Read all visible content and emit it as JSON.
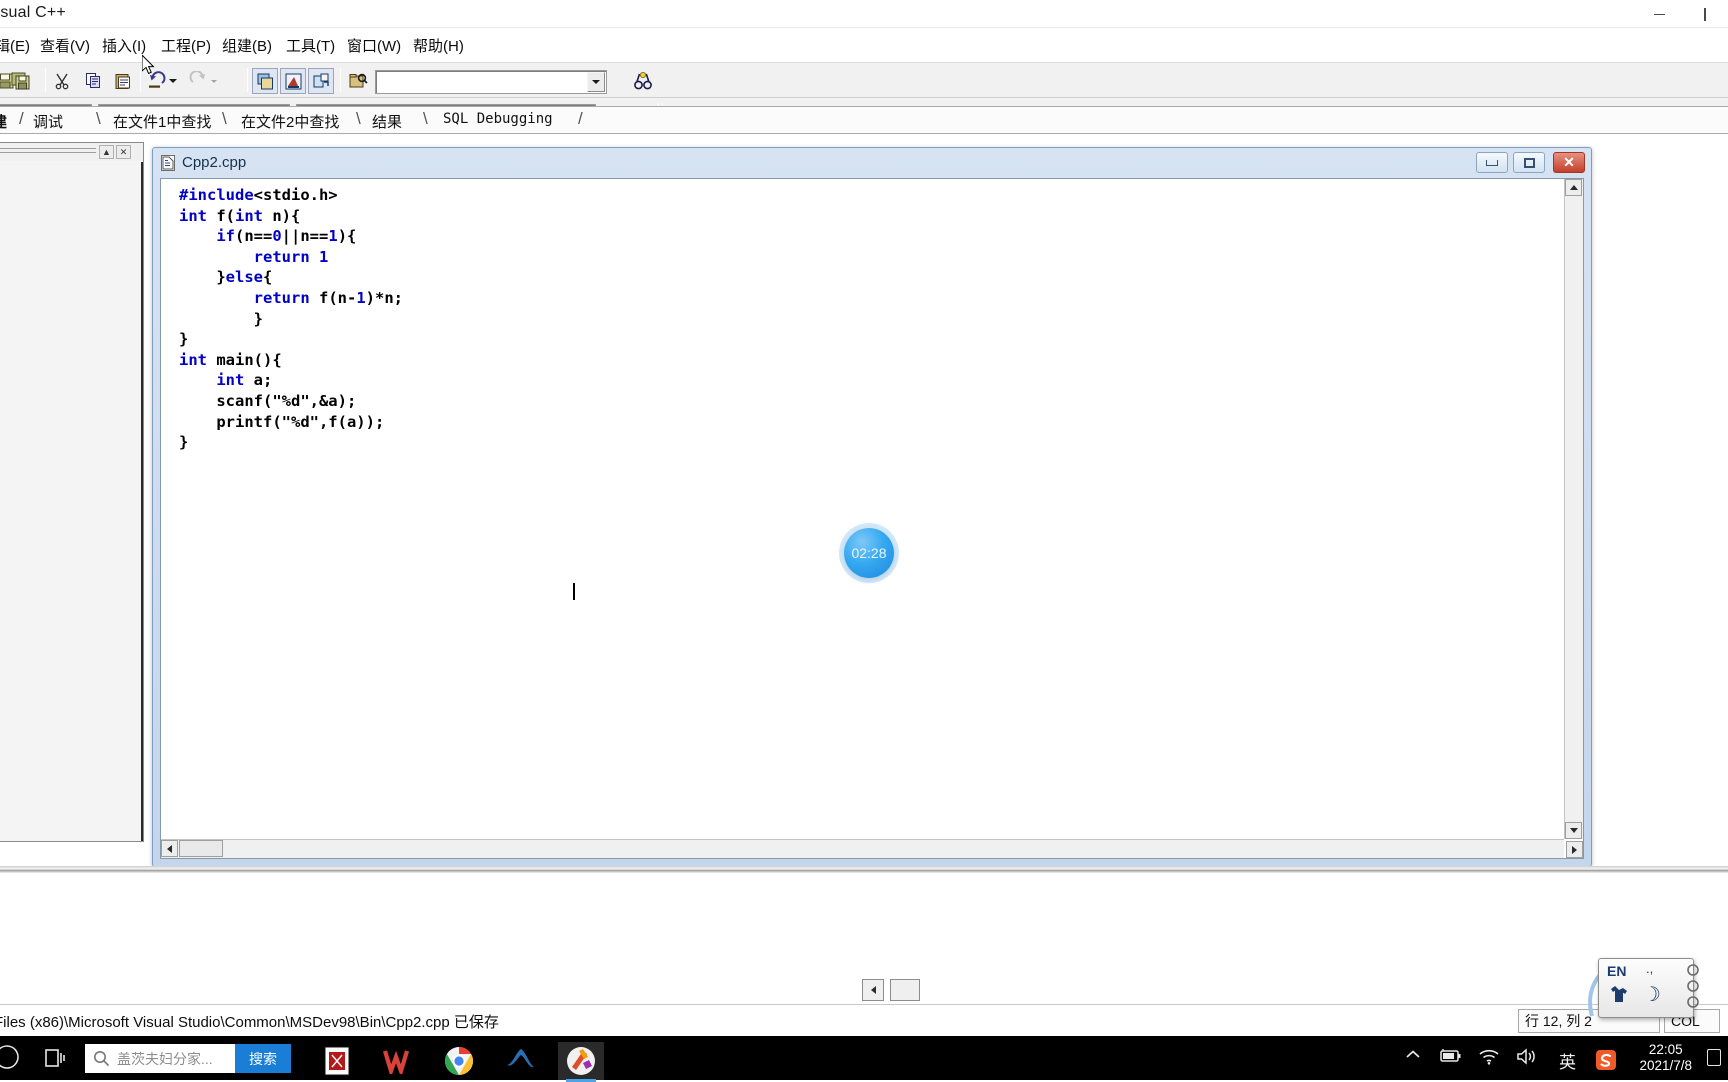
{
  "window": {
    "app_title": "Visual C++",
    "minimize_label": "minimize",
    "restore_label": "restore"
  },
  "menubar": {
    "items": [
      {
        "label": "辑(E)",
        "key": "E"
      },
      {
        "label": "查看(V)",
        "key": "V"
      },
      {
        "label": "插入(I)",
        "key": "I"
      },
      {
        "label": "工程(P)",
        "key": "P"
      },
      {
        "label": "组建(B)",
        "key": "B"
      },
      {
        "label": "工具(T)",
        "key": "T"
      },
      {
        "label": "窗口(W)",
        "key": "W"
      },
      {
        "label": "帮助(H)",
        "key": "H"
      }
    ]
  },
  "toolbar1": {
    "icons": [
      "save-icon",
      "save-all-icon",
      "cut-icon",
      "copy-icon",
      "paste-icon",
      "undo-icon",
      "undo-dropdown-icon",
      "redo-icon",
      "redo-dropdown-icon",
      "workspace-icon",
      "output-window-icon",
      "window-list-icon",
      "find-in-files-icon",
      "search-dropdown-icon",
      "find-binoculars-icon"
    ],
    "find_combo_value": "",
    "find_combo_placeholder": ""
  },
  "toolbar2": {
    "combo1_value": "",
    "combo2_value": "",
    "combo3_value": "",
    "icons": [
      "wizardbar-icon",
      "compile-icon",
      "build-icon",
      "stop-build-icon",
      "execute-icon",
      "go-debug-icon",
      "insert-breakpoint-icon"
    ]
  },
  "workspace_pane": {
    "collapse_label": "▲",
    "close_label": "✕"
  },
  "child_window": {
    "title": "Cpp2.cpp",
    "icon": "cpp-file-icon",
    "minimize_label": "minimize",
    "maximize_label": "maximize",
    "close_label": "✕",
    "code_lines": [
      {
        "indent": 0,
        "tokens": [
          {
            "t": "kw",
            "v": "#include"
          },
          {
            "t": "n",
            "v": "<stdio.h>"
          }
        ]
      },
      {
        "indent": 0,
        "tokens": [
          {
            "t": "kw",
            "v": "int"
          },
          {
            "t": "n",
            "v": " f("
          },
          {
            "t": "kw",
            "v": "int"
          },
          {
            "t": "n",
            "v": " n){"
          }
        ]
      },
      {
        "indent": 1,
        "tokens": [
          {
            "t": "kw",
            "v": "if"
          },
          {
            "t": "n",
            "v": "(n=="
          },
          {
            "t": "kw",
            "v": "0"
          },
          {
            "t": "n",
            "v": "||n=="
          },
          {
            "t": "kw",
            "v": "1"
          },
          {
            "t": "n",
            "v": "){"
          }
        ]
      },
      {
        "indent": 2,
        "tokens": [
          {
            "t": "kw",
            "v": "return"
          },
          {
            "t": "n",
            "v": " "
          },
          {
            "t": "kw",
            "v": "1"
          }
        ]
      },
      {
        "indent": 1,
        "tokens": [
          {
            "t": "n",
            "v": "}"
          },
          {
            "t": "kw",
            "v": "else"
          },
          {
            "t": "n",
            "v": "{"
          }
        ]
      },
      {
        "indent": 2,
        "tokens": [
          {
            "t": "kw",
            "v": "return"
          },
          {
            "t": "n",
            "v": " f(n-"
          },
          {
            "t": "kw",
            "v": "1"
          },
          {
            "t": "n",
            "v": ")*n;"
          }
        ]
      },
      {
        "indent": 2,
        "tokens": [
          {
            "t": "n",
            "v": "}"
          }
        ]
      },
      {
        "indent": 0,
        "tokens": [
          {
            "t": "n",
            "v": "}"
          }
        ]
      },
      {
        "indent": 0,
        "tokens": [
          {
            "t": "kw",
            "v": "int"
          },
          {
            "t": "n",
            "v": " main(){"
          }
        ]
      },
      {
        "indent": 1,
        "tokens": [
          {
            "t": "kw",
            "v": "int"
          },
          {
            "t": "n",
            "v": " a;"
          }
        ]
      },
      {
        "indent": 1,
        "tokens": [
          {
            "t": "n",
            "v": "scanf(\"%d\",&a);"
          }
        ]
      },
      {
        "indent": 1,
        "tokens": [
          {
            "t": "n",
            "v": "printf(\"%d\",f(a));"
          }
        ]
      },
      {
        "indent": 0,
        "tokens": [
          {
            "t": "n",
            "v": "}"
          }
        ]
      }
    ],
    "code_plain": "#include<stdio.h>\nint f(int n){\n    if(n==0||n==1){\n        return 1\n    }else{\n        return f(n-1)*n;\n        }\n}\nint main(){\n    int a;\n    scanf(\"%d\",&a);\n    printf(\"%d\",f(a));\n}"
  },
  "timer_bubble": {
    "value": "02:28",
    "color": "#2aa0ee"
  },
  "output_tabs": {
    "items": [
      "建",
      "调试",
      "在文件1中查找",
      "在文件2中查找",
      "结果",
      "SQL Debugging"
    ],
    "scroll_left_label": "◀"
  },
  "statusbar": {
    "message": "Files (x86)\\Microsoft Visual Studio\\Common\\MSDev98\\Bin\\Cpp2.cpp 已保存",
    "position": "行 12, 列 2",
    "col_indicator": "COL"
  },
  "ime": {
    "language": "EN",
    "punctuation_icon": ".,",
    "keyboard_icon": "shirt-icon",
    "moon_icon": "moon-icon"
  },
  "taskbar": {
    "start_label": "start",
    "taskview_label": "task-view",
    "search_value": "盖茨夫妇分家...",
    "search_button": "搜索",
    "apps": [
      {
        "name": "app-icon-red-card",
        "glyph": "🀄"
      },
      {
        "name": "app-icon-wps",
        "glyph": "W"
      },
      {
        "name": "app-icon-chrome",
        "glyph": "chrome"
      },
      {
        "name": "app-icon-matlab",
        "glyph": "matlab"
      },
      {
        "name": "app-icon-visual-cpp",
        "glyph": "vcpp"
      }
    ],
    "tray": [
      {
        "name": "show-hidden-icons",
        "glyph": "^"
      },
      {
        "name": "battery-icon",
        "glyph": "battery"
      },
      {
        "name": "wifi-icon",
        "glyph": "wifi"
      },
      {
        "name": "volume-icon",
        "glyph": "volume"
      },
      {
        "name": "ime-english-icon",
        "glyph": "英"
      },
      {
        "name": "sogou-icon",
        "glyph": "S"
      }
    ],
    "clock_time": "22:05",
    "clock_date": "2021/7/8",
    "notification_label": "notifications"
  }
}
